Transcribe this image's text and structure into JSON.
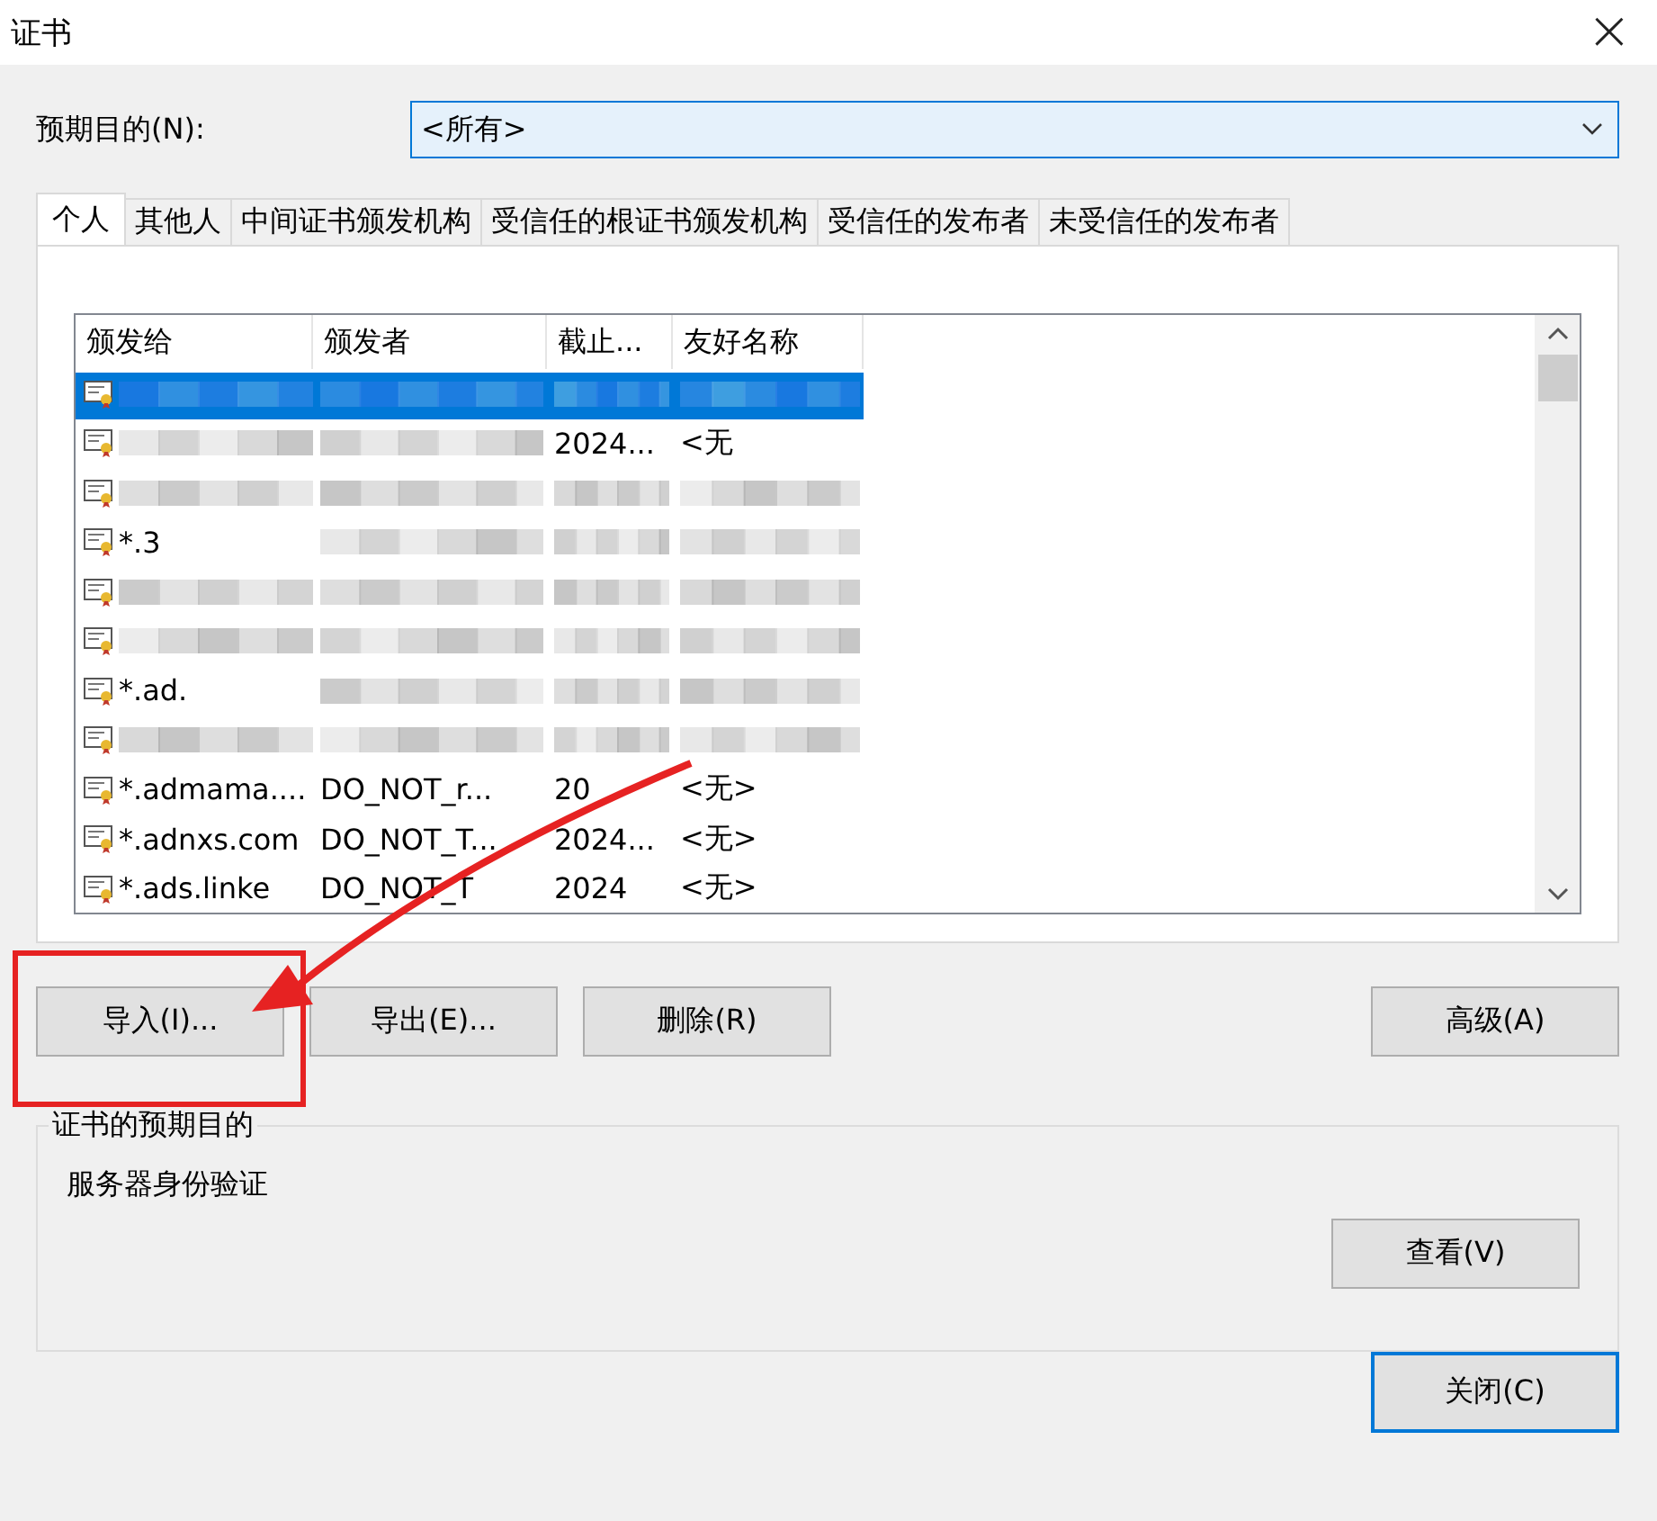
{
  "window": {
    "title": "证书",
    "close": "×"
  },
  "purpose_filter": {
    "label": "预期目的(N):",
    "value": "<所有>"
  },
  "tabs": [
    {
      "label": "个人",
      "selected": true
    },
    {
      "label": "其他人",
      "selected": false
    },
    {
      "label": "中间证书颁发机构",
      "selected": false
    },
    {
      "label": "受信任的根证书颁发机构",
      "selected": false
    },
    {
      "label": "受信任的发布者",
      "selected": false
    },
    {
      "label": "未受信任的发布者",
      "selected": false
    }
  ],
  "table": {
    "columns": [
      "颁发给",
      "颁发者",
      "截止...",
      "友好名称"
    ],
    "rows": [
      {
        "selected": true,
        "cells": [
          null,
          null,
          null,
          null
        ]
      },
      {
        "selected": false,
        "cells": [
          null,
          null,
          "2024...",
          "<无"
        ]
      },
      {
        "selected": false,
        "cells": [
          null,
          null,
          null,
          null
        ]
      },
      {
        "selected": false,
        "cells": [
          "*.3",
          null,
          null,
          null
        ]
      },
      {
        "selected": false,
        "cells": [
          null,
          null,
          null,
          null
        ]
      },
      {
        "selected": false,
        "cells": [
          null,
          null,
          null,
          null
        ]
      },
      {
        "selected": false,
        "cells": [
          "*.ad.",
          null,
          null,
          null
        ]
      },
      {
        "selected": false,
        "cells": [
          null,
          null,
          null,
          null
        ]
      },
      {
        "selected": false,
        "cells": [
          "*.admama....",
          "DO_NOT_r...",
          "20",
          "<无>"
        ]
      },
      {
        "selected": false,
        "cells": [
          "*.adnxs.com",
          "DO_NOT_T...",
          "2024...",
          "<无>"
        ]
      },
      {
        "selected": false,
        "cells": [
          "*.ads.linke",
          "DO_NOT_T",
          "2024",
          "<无>"
        ]
      }
    ]
  },
  "actions": [
    "导入(I)...",
    "导出(E)...",
    "删除(R)"
  ],
  "advanced_button": "高级(A)",
  "purposes_group": {
    "title": "证书的预期目的",
    "text": "服务器身份验证",
    "view_button": "查看(V)"
  },
  "close_button": "关闭(C)"
}
